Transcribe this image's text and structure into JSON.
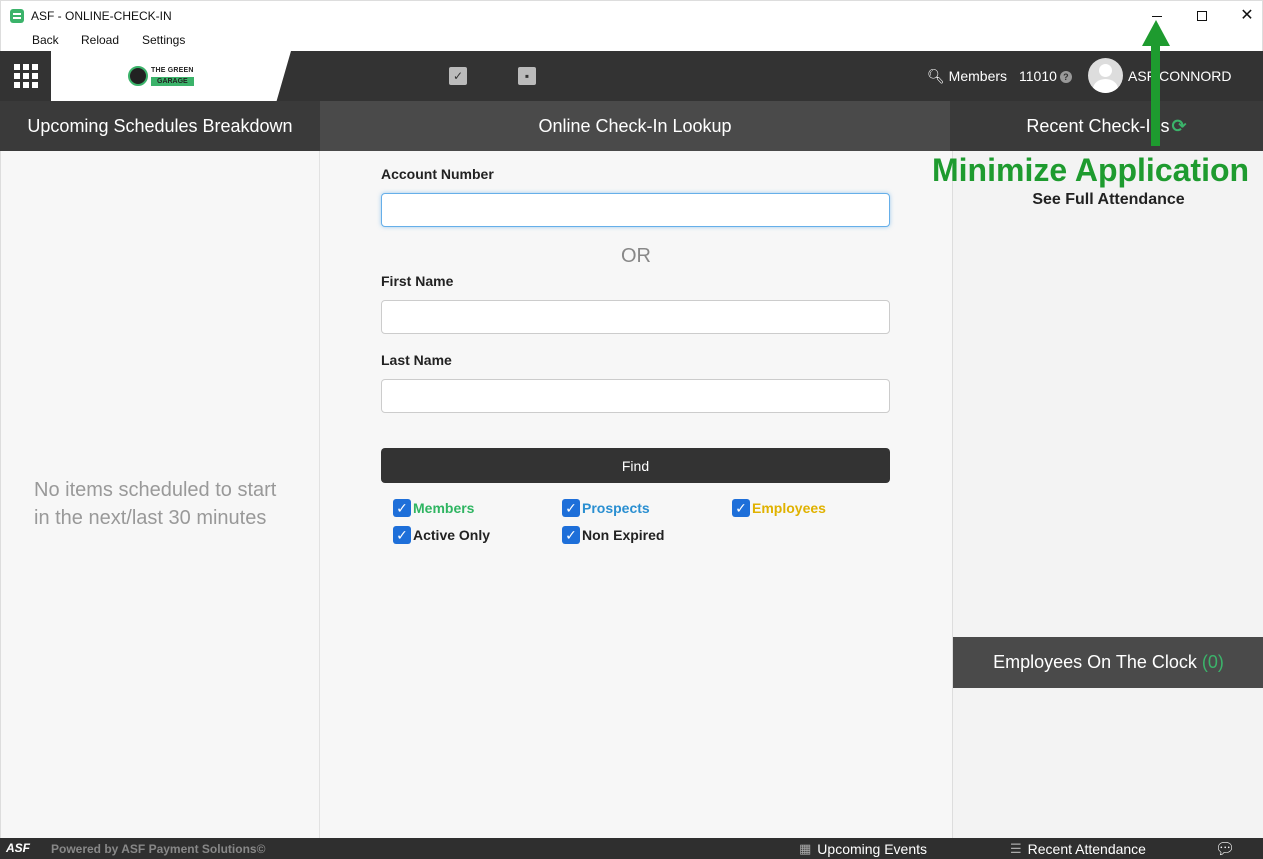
{
  "window": {
    "title": "ASF - ONLINE-CHECK-IN",
    "minimize_glyph": "–",
    "maximize_glyph": "☐",
    "close_glyph": "✕"
  },
  "menu": {
    "back": "Back",
    "reload": "Reload",
    "settings": "Settings"
  },
  "navbar": {
    "logo_top": "THE GREEN",
    "logo_bottom": "GARAGE",
    "members_label": "Members",
    "number": "11010",
    "username": "ASF CONNORD"
  },
  "panels": {
    "left_title": "Upcoming Schedules Breakdown",
    "mid_title": "Online Check-In Lookup",
    "right_title": "Recent Check-Ins"
  },
  "left": {
    "empty_message": "No items scheduled to start in the next/last 30 minutes"
  },
  "lookup": {
    "account_label": "Account Number",
    "account_value": "",
    "or_text": "OR",
    "first_label": "First Name",
    "first_value": "",
    "last_label": "Last Name",
    "last_value": "",
    "find_label": "Find",
    "filters": {
      "members": "Members",
      "prospects": "Prospects",
      "employees": "Employees",
      "active_only": "Active Only",
      "non_expired": "Non Expired"
    }
  },
  "right": {
    "see_full": "See Full Attendance",
    "employees_clock": "Employees On The Clock",
    "employees_count": "(0)"
  },
  "annotation": {
    "text": "Minimize Application",
    "color": "#1e9b2f"
  },
  "footer": {
    "brand": "ASF",
    "powered": "Powered by ASF Payment Solutions©",
    "upcoming_events": "Upcoming Events",
    "recent_attendance": "Recent Attendance"
  },
  "colors": {
    "members": "#2fb562",
    "prospects": "#2a8fd1",
    "employees": "#e0b200",
    "checkbox": "#1e6fd9",
    "navbar": "#333333"
  },
  "icons": {
    "apps": "grid-icon",
    "check": "checkbox-icon",
    "contact": "contact-book-icon",
    "search": "search-icon",
    "help": "help-icon",
    "refresh": "refresh-icon",
    "calendar": "calendar-icon",
    "list": "list-icon",
    "chat": "chat-icon"
  }
}
